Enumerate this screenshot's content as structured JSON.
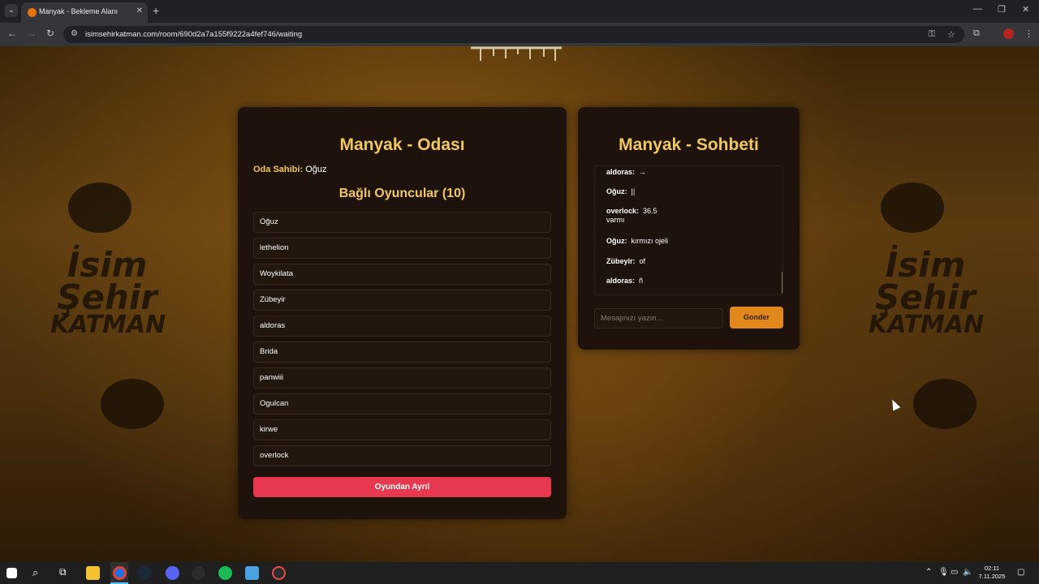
{
  "browser": {
    "tab_title": "Manyak - Bekleme Alanı",
    "url": "isimsehirkatman.com/room/690d2a7a155f9222a4fef746/waiting"
  },
  "background": {
    "logo_lines": [
      "İsim",
      "Şehir",
      "KATMAN"
    ]
  },
  "room": {
    "title": "Manyak - Odası",
    "owner_label": "Oda Sahibi:",
    "owner_name": "Oğuz",
    "players_title": "Bağlı Oyuncular (10)",
    "players": [
      "Oğuz",
      "lethelion",
      "Woykilata",
      "Zübeyir",
      "aldoras",
      "Brida",
      "panwiii",
      "Ogulcan",
      "kirwe",
      "overlock"
    ],
    "leave_button": "Oyundan Ayrıl"
  },
  "chat": {
    "title": "Manyak - Sohbeti",
    "messages": [
      {
        "user": "aldoras:",
        "text": "→"
      },
      {
        "user": "Oğuz:",
        "text": "||"
      },
      {
        "user": "overlock:",
        "text": "36.5 varmı"
      },
      {
        "user": "Oğuz:",
        "text": "kırmızı ojeli"
      },
      {
        "user": "Zübeyir:",
        "text": "of"
      },
      {
        "user": "aldoras:",
        "text": "ñ"
      }
    ],
    "input_placeholder": "Mesajınızı yazın...",
    "send_button": "Gonder"
  },
  "taskbar": {
    "time": "02:11",
    "date": "7.11.2025"
  },
  "colors": {
    "accent_gold": "#f1c75f",
    "leave_red": "#e8384f",
    "send_orange": "#e0881c",
    "panel_bg": "#1e130c"
  }
}
